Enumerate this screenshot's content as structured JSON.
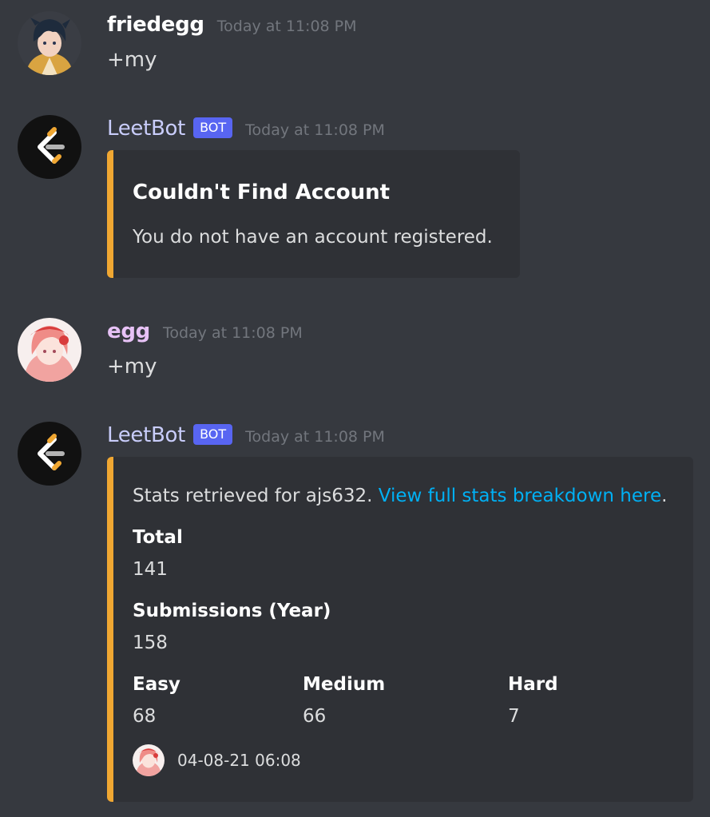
{
  "messages": [
    {
      "username": "friedegg",
      "username_color": "#ffffff",
      "timestamp": "Today at 11:08 PM",
      "text": "+my",
      "avatar": "anime-boy-avatar"
    },
    {
      "username": "LeetBot",
      "username_color": "#c9cdfb",
      "bot_tag": "BOT",
      "timestamp": "Today at 11:08 PM",
      "avatar": "leetcode-logo-avatar",
      "embed": {
        "accent_color": "#f0a732",
        "title": "Couldn't Find Account",
        "description": "You do not have an account registered."
      }
    },
    {
      "username": "egg",
      "username_color": "#e7c2f6",
      "timestamp": "Today at 11:08 PM",
      "text": "+my",
      "avatar": "anime-girl-avatar"
    },
    {
      "username": "LeetBot",
      "username_color": "#c9cdfb",
      "bot_tag": "BOT",
      "timestamp": "Today at 11:08 PM",
      "avatar": "leetcode-logo-avatar",
      "embed": {
        "accent_color": "#f0a732",
        "description_prefix": "Stats retrieved for ajs632. ",
        "description_link": "View full stats breakdown here",
        "description_suffix": ".",
        "fields": [
          {
            "name": "Total",
            "value": "141"
          },
          {
            "name": "Submissions (Year)",
            "value": "158"
          },
          {
            "name": "Easy",
            "value": "68"
          },
          {
            "name": "Medium",
            "value": "66"
          },
          {
            "name": "Hard",
            "value": "7"
          }
        ],
        "footer_text": "04-08-21 06:08",
        "footer_icon": "anime-girl-avatar"
      }
    }
  ],
  "colors": {
    "background": "#36393f",
    "embed_background": "#2f3136",
    "link": "#00b0f4",
    "bot_tag": "#5865f2",
    "timestamp": "#72767d"
  }
}
